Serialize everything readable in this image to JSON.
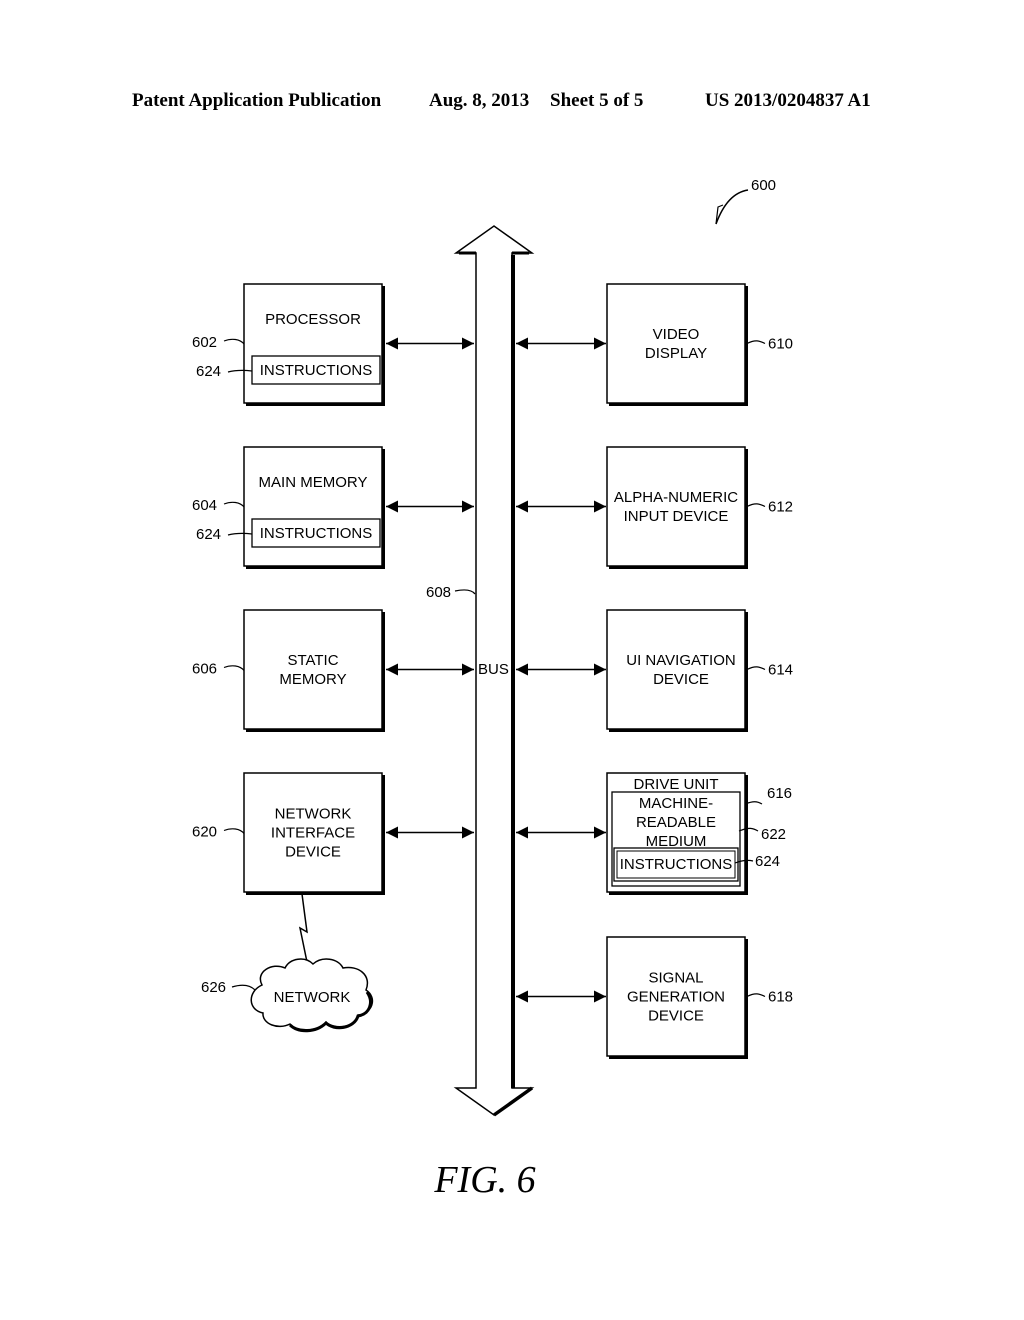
{
  "header": {
    "publication": "Patent Application Publication",
    "date": "Aug. 8, 2013",
    "sheet": "Sheet 5 of 5",
    "number": "US 2013/0204837 A1"
  },
  "figure": {
    "caption": "FIG. 6",
    "system_ref": "600",
    "bus": {
      "label": "BUS",
      "ref": "608"
    },
    "left_blocks": [
      {
        "id": "processor",
        "lines": [
          "PROCESSOR"
        ],
        "ref": "602",
        "inner": {
          "label": "INSTRUCTIONS",
          "ref": "624"
        }
      },
      {
        "id": "main-memory",
        "lines": [
          "MAIN MEMORY"
        ],
        "ref": "604",
        "inner": {
          "label": "INSTRUCTIONS",
          "ref": "624"
        }
      },
      {
        "id": "static-memory",
        "lines": [
          "STATIC",
          "MEMORY"
        ],
        "ref": "606"
      },
      {
        "id": "network-interface-device",
        "lines": [
          "NETWORK",
          "INTERFACE",
          "DEVICE"
        ],
        "ref": "620"
      }
    ],
    "right_blocks": [
      {
        "id": "video-display",
        "lines": [
          "VIDEO",
          "DISPLAY"
        ],
        "ref": "610"
      },
      {
        "id": "alpha-numeric-input-device",
        "lines": [
          "ALPHA-NUMERIC",
          "INPUT DEVICE"
        ],
        "ref": "612"
      },
      {
        "id": "ui-navigation-device",
        "lines": [
          "UI NAVIGATION",
          "DEVICE"
        ],
        "ref": "614"
      },
      {
        "id": "drive-unit",
        "lines": [
          "DRIVE UNIT"
        ],
        "ref": "616",
        "medium": {
          "lines": [
            "MACHINE-",
            "READABLE",
            "MEDIUM"
          ],
          "ref": "622"
        },
        "inner": {
          "label": "INSTRUCTIONS",
          "ref": "624"
        }
      },
      {
        "id": "signal-generation-device",
        "lines": [
          "SIGNAL",
          "GENERATION",
          "DEVICE"
        ],
        "ref": "618"
      }
    ],
    "network": {
      "label": "NETWORK",
      "ref": "626"
    }
  }
}
